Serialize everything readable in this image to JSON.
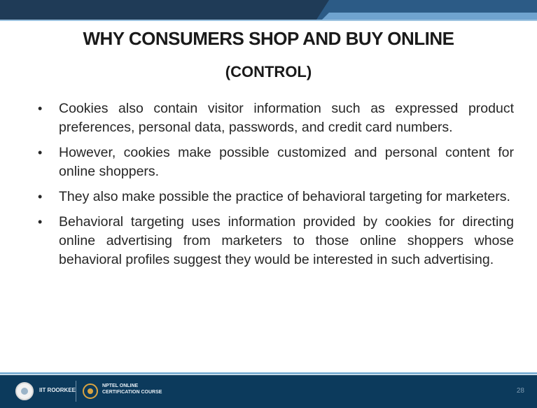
{
  "slide": {
    "title": "WHY CONSUMERS SHOP AND BUY ONLINE",
    "subtitle": "(CONTROL)",
    "bullets": [
      "Cookies also contain visitor information such as expressed product preferences, personal data, passwords, and credit card numbers.",
      "However, cookies make possible customized and personal content for online shoppers.",
      "They also make possible the practice of behavioral targeting for marketers.",
      "Behavioral targeting uses information provided by cookies for directing online advertising from marketers to those online shoppers whose behavioral profiles suggest they would be interested in such advertising."
    ]
  },
  "footer": {
    "institute": "IIT ROORKEE",
    "course_line1": "NPTEL ONLINE",
    "course_line2": "CERTIFICATION COURSE",
    "page_number": "28"
  },
  "colors": {
    "top_bar": "#1f3b57",
    "top_bar_accent": "#6fa3cf",
    "footer_band": "#0c3a5c"
  }
}
